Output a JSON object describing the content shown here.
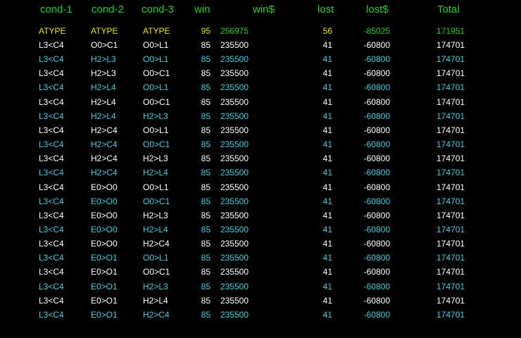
{
  "colors": {
    "background": "#000000",
    "header": "#1fd11f",
    "summary_text": "#e6e600",
    "summary_values": "#1fd11f",
    "row_white": "#ffffff",
    "row_cyan": "#3ad0e0"
  },
  "table": {
    "headers": [
      "cond-1",
      "cond-2",
      "cond-3",
      "win",
      "win$",
      "lost",
      "lost$",
      "Total"
    ],
    "summary": [
      "ATYPE",
      "ATYPE",
      "ATYPE",
      "95",
      "256975",
      "56",
      "-85025",
      "171951"
    ],
    "rows": [
      [
        "L3<C4",
        "O0>C1",
        "O0>L1",
        "85",
        "235500",
        "41",
        "-60800",
        "174701"
      ],
      [
        "L3<C4",
        "H2>L3",
        "O0>L1",
        "85",
        "235500",
        "41",
        "-60800",
        "174701"
      ],
      [
        "L3<C4",
        "H2>L3",
        "O0>C1",
        "85",
        "235500",
        "41",
        "-60800",
        "174701"
      ],
      [
        "L3<C4",
        "H2>L4",
        "O0>L1",
        "85",
        "235500",
        "41",
        "-60800",
        "174701"
      ],
      [
        "L3<C4",
        "H2>L4",
        "O0>C1",
        "85",
        "235500",
        "41",
        "-60800",
        "174701"
      ],
      [
        "L3<C4",
        "H2>L4",
        "H2>L3",
        "85",
        "235500",
        "41",
        "-60800",
        "174701"
      ],
      [
        "L3<C4",
        "H2>C4",
        "O0>L1",
        "85",
        "235500",
        "41",
        "-60800",
        "174701"
      ],
      [
        "L3<C4",
        "H2>C4",
        "O0>C1",
        "85",
        "235500",
        "41",
        "-60800",
        "174701"
      ],
      [
        "L3<C4",
        "H2>C4",
        "H2>L3",
        "85",
        "235500",
        "41",
        "-60800",
        "174701"
      ],
      [
        "L3<C4",
        "H2>C4",
        "H2>L4",
        "85",
        "235500",
        "41",
        "-60800",
        "174701"
      ],
      [
        "L3<C4",
        "E0>O0",
        "O0>L1",
        "85",
        "235500",
        "41",
        "-60800",
        "174701"
      ],
      [
        "L3<C4",
        "E0>O0",
        "O0>C1",
        "85",
        "235500",
        "41",
        "-60800",
        "174701"
      ],
      [
        "L3<C4",
        "E0>O0",
        "H2>L3",
        "85",
        "235500",
        "41",
        "-60800",
        "174701"
      ],
      [
        "L3<C4",
        "E0>O0",
        "H2>L4",
        "85",
        "235500",
        "41",
        "-60800",
        "174701"
      ],
      [
        "L3<C4",
        "E0>O0",
        "H2>C4",
        "85",
        "235500",
        "41",
        "-60800",
        "174701"
      ],
      [
        "L3<C4",
        "E0>O1",
        "O0>L1",
        "85",
        "235500",
        "41",
        "-60800",
        "174701"
      ],
      [
        "L3<C4",
        "E0>O1",
        "O0>C1",
        "85",
        "235500",
        "41",
        "-60800",
        "174701"
      ],
      [
        "L3<C4",
        "E0>O1",
        "H2>L3",
        "85",
        "235500",
        "41",
        "-60800",
        "174701"
      ],
      [
        "L3<C4",
        "E0>O1",
        "H2>L4",
        "85",
        "235500",
        "41",
        "-60800",
        "174701"
      ],
      [
        "L3<C4",
        "E0>O1",
        "H2>C4",
        "85",
        "235500",
        "41",
        "-60800",
        "174701"
      ]
    ]
  }
}
